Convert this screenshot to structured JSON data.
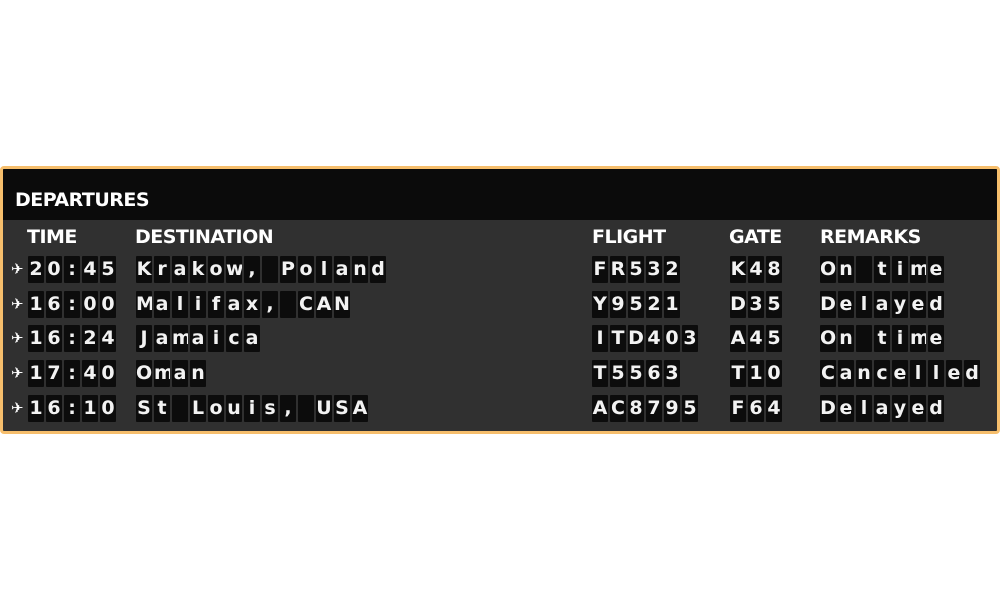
{
  "board": {
    "title": "DEPARTURES",
    "colors": {
      "frame": "#f6be6c",
      "header_bg": "#0b0b0b",
      "body_bg": "#303030",
      "cell_bg": "#0c0c0c",
      "text": "#ffffff"
    },
    "columns": {
      "time": "TIME",
      "destination": "DESTINATION",
      "flight": "FLIGHT",
      "gate": "GATE",
      "remarks": "REMARKS"
    },
    "row_icon": "airplane-icon",
    "rows": [
      {
        "time": "20:45",
        "destination": "Krakow, Poland",
        "flight": "FR532",
        "gate": "K48",
        "remarks": "On time"
      },
      {
        "time": "16:00",
        "destination": "Malifax, CAN",
        "flight": "Y9521",
        "gate": "D35",
        "remarks": "Delayed"
      },
      {
        "time": "16:24",
        "destination": "Jamaica",
        "flight": "ITD403",
        "gate": "A45",
        "remarks": "On time"
      },
      {
        "time": "17:40",
        "destination": "Oman",
        "flight": "T5563",
        "gate": "T10",
        "remarks": "Cancelled"
      },
      {
        "time": "16:10",
        "destination": "St Louis, USA",
        "flight": "AC8795",
        "gate": "F64",
        "remarks": "Delayed"
      }
    ]
  }
}
